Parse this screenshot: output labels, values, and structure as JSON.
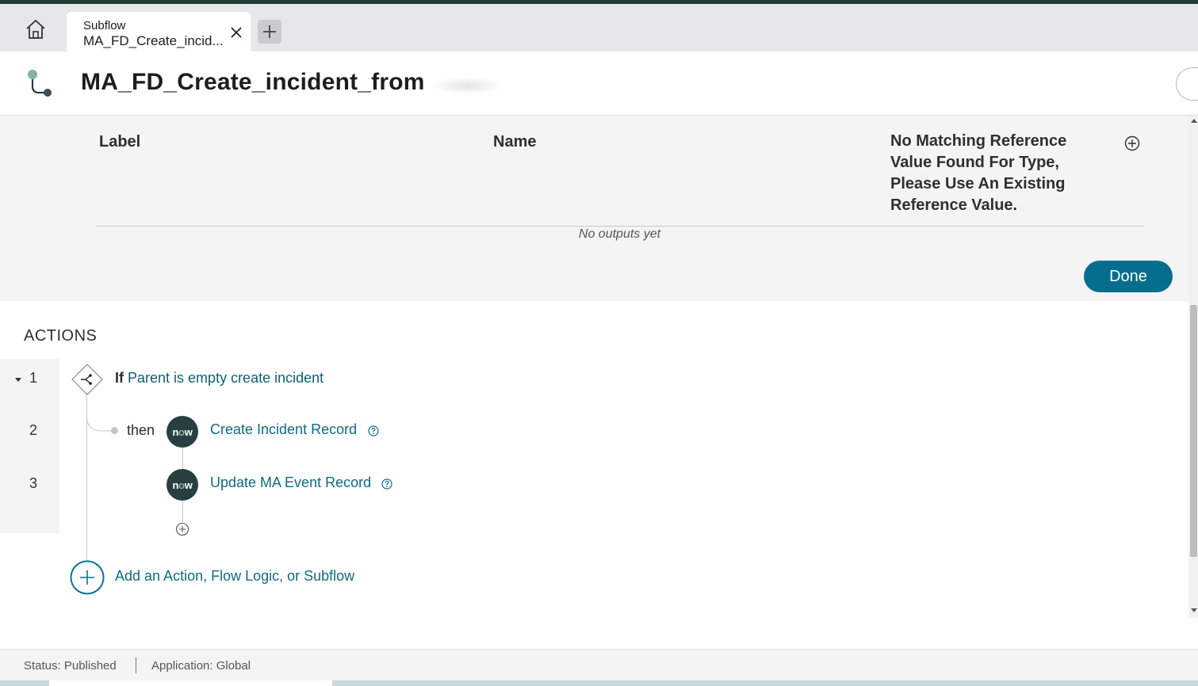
{
  "colors": {
    "accent": "#036e8d",
    "link": "#0e6a87",
    "dark": "#293e40",
    "now_o": "#81b5a1"
  },
  "tab": {
    "type_label": "Subflow",
    "name": "MA_FD_Create_incid...",
    "home_icon": "home-icon",
    "close_icon": "close-icon",
    "add_icon": "plus-icon"
  },
  "header": {
    "title": "MA_FD_Create_incident_from",
    "icon": "subflow-icon"
  },
  "outputs": {
    "columns": [
      "Label",
      "Name",
      "No Matching Reference Value Found For Type, Please Use An Existing Reference Value."
    ],
    "empty_text": "No outputs yet",
    "done_label": "Done"
  },
  "actions": {
    "heading": "ACTIONS",
    "rows": [
      {
        "num": "1",
        "keyword": "If",
        "text": "Parent is empty create incident"
      },
      {
        "num": "2",
        "prefix": "then",
        "badge": "now",
        "text": "Create Incident Record"
      },
      {
        "num": "3",
        "badge": "now",
        "text": "Update MA Event Record"
      }
    ],
    "add_text": "Add an Action, Flow Logic, or Subflow"
  },
  "status": {
    "status": "Status: Published",
    "application": "Application: Global"
  }
}
